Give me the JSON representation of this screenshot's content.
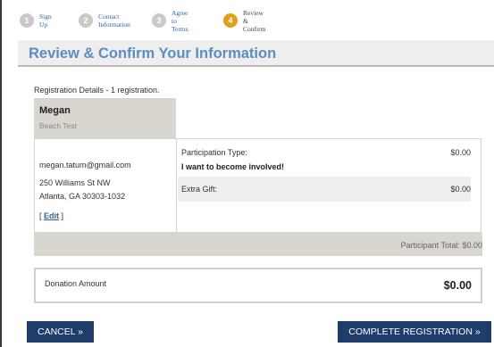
{
  "steps": [
    {
      "number": "1",
      "label": "Sign Up",
      "active": false
    },
    {
      "number": "2",
      "label": "Contact\nInformation",
      "active": false
    },
    {
      "number": "3",
      "label": "Agree to\nTerms",
      "active": false
    },
    {
      "number": "4",
      "label": "Review &\nConfirm",
      "active": true
    }
  ],
  "heading": "Review & Confirm Your Information",
  "registration": {
    "details_label": "Registration Details - 1 registration.",
    "name": "Megan",
    "subtitle": "Beach Test",
    "email": "megan.tatum@gmail.com",
    "address_line1": "250 Williams St NW",
    "address_line2": "Atlanta, GA 30303-1032",
    "edit_open": "[ ",
    "edit_label": "Edit",
    "edit_close": " ]",
    "participation_type_label": "Participation Type:",
    "participation_type_value": "I want to become involved!",
    "participation_type_amount": "$0.00",
    "extra_gift_label": "Extra Gift:",
    "extra_gift_amount": "$0.00",
    "participant_total": "Participant Total: $0.00"
  },
  "donation": {
    "label": "Donation Amount",
    "amount": "$0.00"
  },
  "buttons": {
    "cancel": "CANCEL  »",
    "complete": "COMPLETE REGISTRATION  »"
  },
  "colors": {
    "accent": "#e0a019",
    "heading": "#5a8ec2",
    "link": "#2f64a7",
    "button": "#1e3d6b"
  }
}
